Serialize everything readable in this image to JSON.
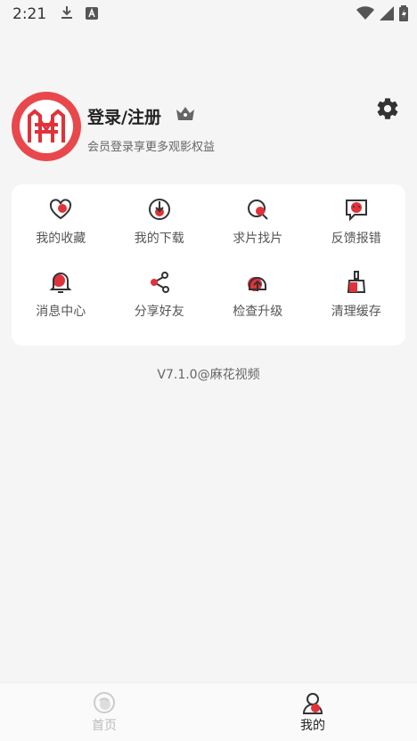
{
  "status_bar": {
    "time": "2:21"
  },
  "profile": {
    "title": "登录/注册",
    "subtitle": "会员登录享更多观影权益"
  },
  "menu": [
    {
      "label": "我的收藏",
      "icon": "heart-icon"
    },
    {
      "label": "我的下载",
      "icon": "download-icon"
    },
    {
      "label": "求片找片",
      "icon": "search-film-icon"
    },
    {
      "label": "反馈报错",
      "icon": "feedback-icon"
    },
    {
      "label": "消息中心",
      "icon": "bell-icon"
    },
    {
      "label": "分享好友",
      "icon": "share-icon"
    },
    {
      "label": "检查升级",
      "icon": "upgrade-icon"
    },
    {
      "label": "清理缓存",
      "icon": "broom-icon"
    }
  ],
  "version": "V7.1.0@麻花视频",
  "bottom_nav": [
    {
      "label": "首页",
      "active": false
    },
    {
      "label": "我的",
      "active": true
    }
  ],
  "colors": {
    "accent": "#e0323a",
    "background": "#f5f5f5"
  }
}
